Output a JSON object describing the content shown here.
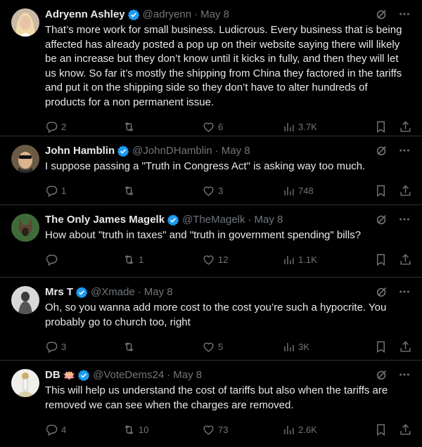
{
  "tweets": [
    {
      "name": "Adryenn Ashley",
      "emoji": "",
      "handle": "@adryenn",
      "sep": "·",
      "date": "May 8",
      "text": "That’s more work for small business. Ludicrous. Every business that is being affected has already posted a pop up on their website saying there will likely be an increase but they don’t know until it kicks in fully, and then they will let us know. So far it’s mostly the shipping from China they factored in the tariffs and put it on the shipping side so they don’t have to alter hundreds of products for a non permanent issue.",
      "replies": "2",
      "reposts": "",
      "likes": "6",
      "views": "3.7K"
    },
    {
      "name": "John Hamblin",
      "emoji": "",
      "handle": "@JohnDHamblin",
      "sep": "·",
      "date": "May 8",
      "text": "I suppose passing a \"Truth in Congress Act\" is asking way too much.",
      "replies": "1",
      "reposts": "",
      "likes": "3",
      "views": "748"
    },
    {
      "name": "The Only James Magelk",
      "emoji": "",
      "handle": "@TheMagelk",
      "sep": "·",
      "date": "May 8",
      "text": "How about  \"truth in taxes\" and  \"truth in government spending\" bills?",
      "replies": "",
      "reposts": "1",
      "likes": "12",
      "views": "1.1K"
    },
    {
      "name": "Mrs T",
      "emoji": "",
      "handle": "@Xmade",
      "sep": "·",
      "date": "May 8",
      "text": "Oh, so you wanna add more cost to the cost you’re such a hypocrite. You probably go to church too, right",
      "replies": "3",
      "reposts": "",
      "likes": "5",
      "views": "3K"
    },
    {
      "name": "DB",
      "emoji": "🪷",
      "handle": "@VoteDems24",
      "sep": "·",
      "date": "May 8",
      "text": "This will help us understand the cost of tariffs but also when the tariffs are removed we can see when the charges are removed.",
      "replies": "4",
      "reposts": "10",
      "likes": "73",
      "views": "2.6K"
    }
  ],
  "colors": {
    "background": "#000000",
    "text": "#e7e9ea",
    "muted": "#71767b",
    "verified": "#1d9bf0",
    "divider": "#2f3336"
  },
  "icons": {
    "verified": "verified-badge-icon",
    "grok": "grok-icon",
    "more": "more-icon",
    "reply": "reply-icon",
    "repost": "repost-icon",
    "like": "like-icon",
    "views": "views-icon",
    "bookmark": "bookmark-icon",
    "share": "share-icon"
  }
}
